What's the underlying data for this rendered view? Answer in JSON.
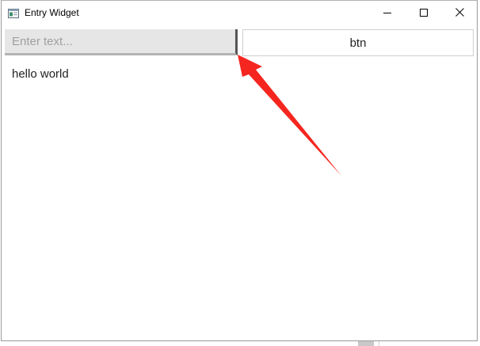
{
  "window": {
    "title": "Entry Widget"
  },
  "entry": {
    "value": "",
    "placeholder": "Enter text..."
  },
  "button": {
    "label": "btn"
  },
  "output_label": {
    "text": "hello world"
  },
  "icons": {
    "app": "app-window-icon",
    "minimize": "minimize-icon",
    "maximize": "maximize-icon",
    "close": "close-icon",
    "annotation": "red-arrow-annotation"
  },
  "colors": {
    "arrow": "#f5261f",
    "entry_bg": "#e6e6e6",
    "entry_focus_border": "#555555"
  }
}
